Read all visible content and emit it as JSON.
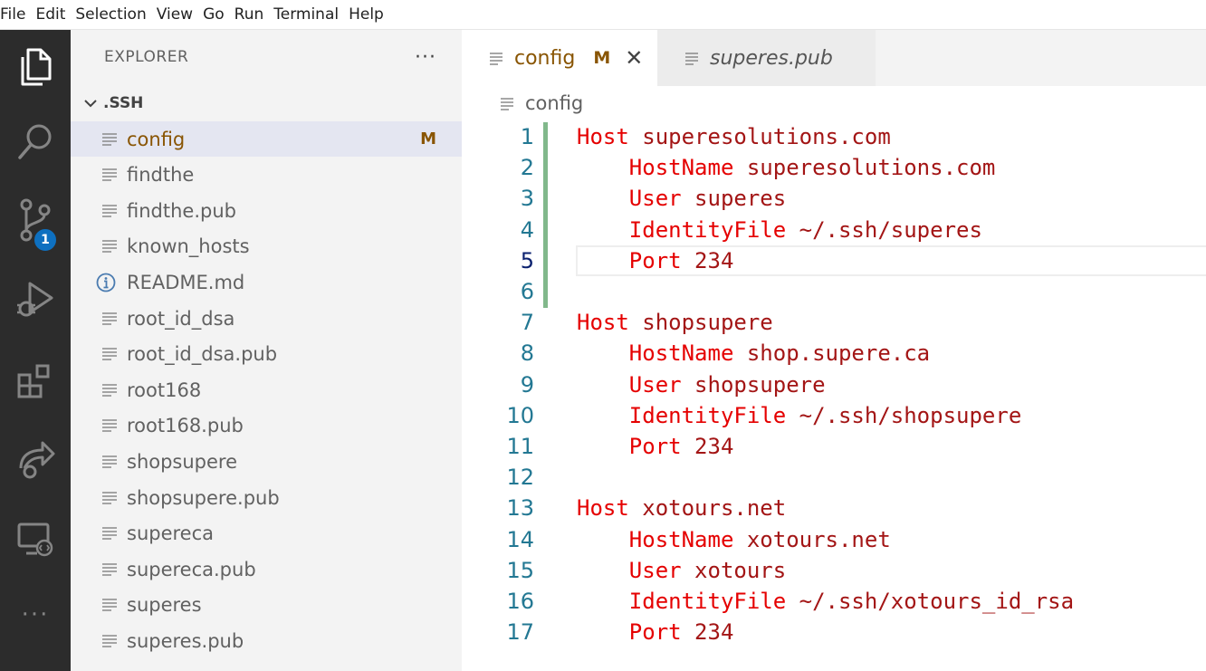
{
  "menu": [
    "File",
    "Edit",
    "Selection",
    "View",
    "Go",
    "Run",
    "Terminal",
    "Help"
  ],
  "activity": {
    "scm_badge": "1",
    "more": "···"
  },
  "explorer": {
    "title": "EXPLORER",
    "more": "···",
    "folder": ".SSH",
    "files": [
      {
        "name": "config",
        "status": "M",
        "selected": true,
        "icon": "lines-icon"
      },
      {
        "name": "findthe",
        "icon": "lines-icon"
      },
      {
        "name": "findthe.pub",
        "icon": "lines-icon"
      },
      {
        "name": "known_hosts",
        "icon": "lines-icon"
      },
      {
        "name": "README.md",
        "icon": "info-icon"
      },
      {
        "name": "root_id_dsa",
        "icon": "lines-icon"
      },
      {
        "name": "root_id_dsa.pub",
        "icon": "lines-icon"
      },
      {
        "name": "root168",
        "icon": "lines-icon"
      },
      {
        "name": "root168.pub",
        "icon": "lines-icon"
      },
      {
        "name": "shopsupere",
        "icon": "lines-icon"
      },
      {
        "name": "shopsupere.pub",
        "icon": "lines-icon"
      },
      {
        "name": "supereca",
        "icon": "lines-icon"
      },
      {
        "name": "supereca.pub",
        "icon": "lines-icon"
      },
      {
        "name": "superes",
        "icon": "lines-icon"
      },
      {
        "name": "superes.pub",
        "icon": "lines-icon"
      }
    ]
  },
  "tabs": [
    {
      "label": "config",
      "status": "M",
      "close": "✕",
      "active": true
    },
    {
      "label": "superes.pub",
      "active": false
    }
  ],
  "breadcrumb": "config",
  "editor": {
    "current_line": 5,
    "lines": [
      {
        "n": "1",
        "k": "Host",
        "v": " superesolutions.com",
        "indent": ""
      },
      {
        "n": "2",
        "k": "HostName",
        "v": " superesolutions.com",
        "indent": "    "
      },
      {
        "n": "3",
        "k": "User",
        "v": " superes",
        "indent": "    "
      },
      {
        "n": "4",
        "k": "IdentityFile",
        "v": " ~/.ssh/superes",
        "indent": "    "
      },
      {
        "n": "5",
        "k": "Port",
        "v": " 234",
        "indent": "    "
      },
      {
        "n": "6",
        "k": "",
        "v": "",
        "indent": ""
      },
      {
        "n": "7",
        "k": "Host",
        "v": " shopsupere",
        "indent": ""
      },
      {
        "n": "8",
        "k": "HostName",
        "v": " shop.supere.ca",
        "indent": "    "
      },
      {
        "n": "9",
        "k": "User",
        "v": " shopsupere",
        "indent": "    "
      },
      {
        "n": "10",
        "k": "IdentityFile",
        "v": " ~/.ssh/shopsupere",
        "indent": "    "
      },
      {
        "n": "11",
        "k": "Port",
        "v": " 234",
        "indent": "    "
      },
      {
        "n": "12",
        "k": "",
        "v": "",
        "indent": ""
      },
      {
        "n": "13",
        "k": "Host",
        "v": " xotours.net",
        "indent": ""
      },
      {
        "n": "14",
        "k": "HostName",
        "v": " xotours.net",
        "indent": "    "
      },
      {
        "n": "15",
        "k": "User",
        "v": " xotours",
        "indent": "    "
      },
      {
        "n": "16",
        "k": "IdentityFile",
        "v": " ~/.ssh/xotours_id_rsa",
        "indent": "    "
      },
      {
        "n": "17",
        "k": "Port",
        "v": " 234",
        "indent": "    "
      }
    ]
  },
  "colors": {
    "keyword": "#e50000",
    "value": "#a31515",
    "line_number": "#237893",
    "modified": "#895503",
    "gutter_added": "#81b88b"
  }
}
